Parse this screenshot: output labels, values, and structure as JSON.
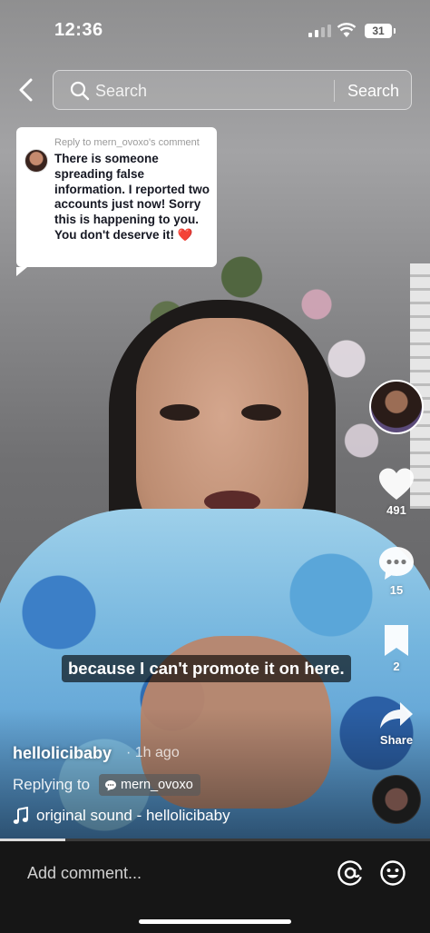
{
  "status_bar": {
    "time": "12:36",
    "battery": "31"
  },
  "search": {
    "placeholder": "Search",
    "button": "Search"
  },
  "reply_sticker": {
    "reply_to": "Reply to mern_ovoxo's comment",
    "text": "There is someone spreading false information. I reported two accounts just now! Sorry this is happening to you. You don't deserve it! ❤️"
  },
  "actions": {
    "likes": "491",
    "comments": "15",
    "bookmarks": "2",
    "share_label": "Share"
  },
  "caption": "because I can't promote it on here.",
  "video_info": {
    "username": "hellolicibaby",
    "time_ago": "· 1h ago",
    "replying_to_label": "Replying to",
    "replying_to_user": "mern_ovoxo",
    "sound": "original sound - hellolicibaby"
  },
  "comment_bar": {
    "placeholder": "Add comment..."
  },
  "colors": {
    "comment_bar_bg": "#161616",
    "sticker_bg": "#ffffff",
    "caption_bg": "rgba(0,0,0,0.62)"
  },
  "icons": [
    "back-icon",
    "search-icon",
    "heart-icon",
    "comment-icon",
    "bookmark-icon",
    "share-icon",
    "music-note-icon",
    "at-icon",
    "emoji-icon"
  ]
}
